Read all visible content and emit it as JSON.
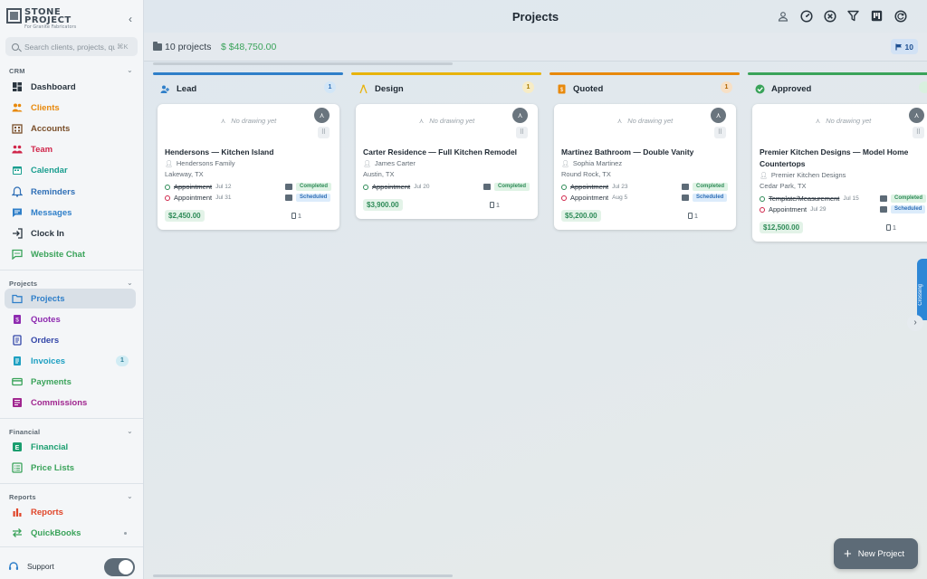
{
  "app": {
    "logo_line1": "STONE",
    "logo_line2": "PROJECT",
    "logo_sub": "For Granite Fabricators"
  },
  "search": {
    "placeholder": "Search clients, projects, qu...",
    "shortcut": "⌘K"
  },
  "sidebar": {
    "sections": [
      {
        "label": "CRM"
      },
      {
        "label": "Projects"
      },
      {
        "label": "Financial"
      },
      {
        "label": "Reports"
      }
    ],
    "crm_items": [
      {
        "label": "Dashboard",
        "color": "#2b3640"
      },
      {
        "label": "Clients",
        "color": "#e8890c"
      },
      {
        "label": "Accounts",
        "color": "#7a4f2a"
      },
      {
        "label": "Team",
        "color": "#d0264a"
      },
      {
        "label": "Calendar",
        "color": "#1a9e8f"
      },
      {
        "label": "Reminders",
        "color": "#2f6fb6"
      },
      {
        "label": "Messages",
        "color": "#2f7fc9"
      },
      {
        "label": "Clock In",
        "color": "#2b3640"
      },
      {
        "label": "Website Chat",
        "color": "#3aa35a"
      }
    ],
    "project_items": [
      {
        "label": "Projects",
        "color": "#2f7fc9",
        "active": true
      },
      {
        "label": "Quotes",
        "color": "#8e2bb0"
      },
      {
        "label": "Orders",
        "color": "#3346a8"
      },
      {
        "label": "Invoices",
        "color": "#1ea0c2",
        "badge": "1"
      },
      {
        "label": "Payments",
        "color": "#3aa35a"
      },
      {
        "label": "Commissions",
        "color": "#a0268f"
      }
    ],
    "financial_items": [
      {
        "label": "Financial",
        "color": "#1a9e6f"
      },
      {
        "label": "Price Lists",
        "color": "#3aa35a"
      }
    ],
    "report_items": [
      {
        "label": "Reports",
        "color": "#e0462a"
      },
      {
        "label": "QuickBooks",
        "color": "#3aa35a"
      }
    ],
    "support_label": "Support"
  },
  "header": {
    "title": "Projects",
    "project_count": "10 projects",
    "total_value": "$  $48,750.00",
    "flag_count": "10"
  },
  "columns": [
    {
      "title": "Lead",
      "count": "1",
      "color": "#2f7fc9",
      "count_bg": "#d2e6f7",
      "count_fg": "#2f6fb6",
      "card": {
        "no_drawing": "No drawing yet",
        "title": "Hendersons — Kitchen Island",
        "client": "Hendersons Family",
        "location": "Lakeway, TX",
        "appointments": [
          {
            "name": "Appointment",
            "date": "Jul 12",
            "status": "Completed",
            "done": true
          },
          {
            "name": "Appointment",
            "date": "Jul 31",
            "status": "Scheduled",
            "done": false
          }
        ],
        "price": "$2,450.00",
        "notes": "1"
      }
    },
    {
      "title": "Design",
      "count": "1",
      "color": "#e8b30c",
      "count_bg": "#f7ecc6",
      "count_fg": "#a57a00",
      "card": {
        "no_drawing": "No drawing yet",
        "title": "Carter Residence — Full Kitchen Remodel",
        "client": "James Carter",
        "location": "Austin, TX",
        "appointments": [
          {
            "name": "Appointment",
            "date": "Jul 20",
            "status": "Completed",
            "done": true
          }
        ],
        "price": "$3,900.00",
        "notes": "1"
      }
    },
    {
      "title": "Quoted",
      "count": "1",
      "color": "#e8890c",
      "count_bg": "#f7e0c6",
      "count_fg": "#b06400",
      "card": {
        "no_drawing": "No drawing yet",
        "title": "Martinez Bathroom — Double Vanity",
        "client": "Sophia Martinez",
        "location": "Round Rock, TX",
        "appointments": [
          {
            "name": "Appointment",
            "date": "Jul 23",
            "status": "Completed",
            "done": true
          },
          {
            "name": "Appointment",
            "date": "Aug 5",
            "status": "Scheduled",
            "done": false
          }
        ],
        "price": "$5,200.00",
        "notes": "1"
      }
    },
    {
      "title": "Approved",
      "count": "",
      "color": "#3aa35a",
      "count_bg": "#d9f0df",
      "count_fg": "#2e8b57",
      "card": {
        "no_drawing": "No drawing yet",
        "title": "Premier Kitchen Designs — Model Home Countertops",
        "client": "Premier Kitchen Designs",
        "location": "Cedar Park, TX",
        "appointments": [
          {
            "name": "Template/Measurement",
            "date": "Jul 15",
            "status": "Completed",
            "done": true
          },
          {
            "name": "Appointment",
            "date": "Jul 29",
            "status": "Scheduled",
            "done": false
          }
        ],
        "price": "$12,500.00",
        "notes": "1"
      }
    }
  ],
  "side_tab": {
    "label": "Crossing"
  },
  "fab": {
    "label": "New Project"
  }
}
